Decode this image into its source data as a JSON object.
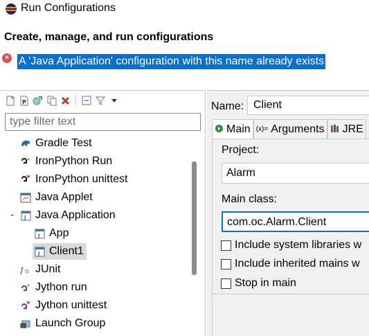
{
  "window": {
    "title": "Run Configurations"
  },
  "header": {
    "heading": "Create, manage, and run configurations",
    "error_message": "A 'Java Application' configuration with this name already exists"
  },
  "toolbar": {
    "buttons": [
      "new-launch-configuration-icon",
      "new-prototype-icon",
      "export-icon",
      "duplicate-icon",
      "delete-icon",
      "collapse-all-icon",
      "filter-icon",
      "view-menu-icon"
    ]
  },
  "filter": {
    "placeholder": "type filter text"
  },
  "tree": {
    "items": [
      {
        "label": "Gradle Test",
        "icon": "gradle-icon"
      },
      {
        "label": "IronPython Run",
        "icon": "python-run-icon"
      },
      {
        "label": "IronPython unittest",
        "icon": "python-unittest-icon"
      },
      {
        "label": "Java Applet",
        "icon": "applet-icon"
      },
      {
        "label": "Java Application",
        "icon": "java-application-icon",
        "expanded": true
      },
      {
        "label": "App",
        "icon": "java-config-icon"
      },
      {
        "label": "Client1",
        "icon": "java-config-icon",
        "selected": true
      },
      {
        "label": "JUnit",
        "icon": "junit-icon"
      },
      {
        "label": "Jython run",
        "icon": "jython-run-icon"
      },
      {
        "label": "Jython unittest",
        "icon": "jython-unittest-icon"
      },
      {
        "label": "Launch Group",
        "icon": "launch-group-icon"
      }
    ]
  },
  "config": {
    "name_label": "Name:",
    "name_value": "Client",
    "tabs": [
      {
        "label": "Main",
        "icon": "main-tab-icon",
        "active": true
      },
      {
        "label": "Arguments",
        "icon": "arguments-icon"
      },
      {
        "label": "JRE",
        "icon": "jre-icon"
      }
    ],
    "project_label": "Project:",
    "project_value": "Alarm",
    "main_class_label": "Main class:",
    "main_class_value": "com.oc.Alarm.Client",
    "checkboxes": [
      {
        "label": "Include system libraries w",
        "checked": false
      },
      {
        "label": "Include inherited mains w",
        "checked": false
      },
      {
        "label": "Stop in main",
        "checked": false
      }
    ]
  },
  "colors": {
    "selection": "#0b6fd0",
    "error": "#d9534f"
  }
}
